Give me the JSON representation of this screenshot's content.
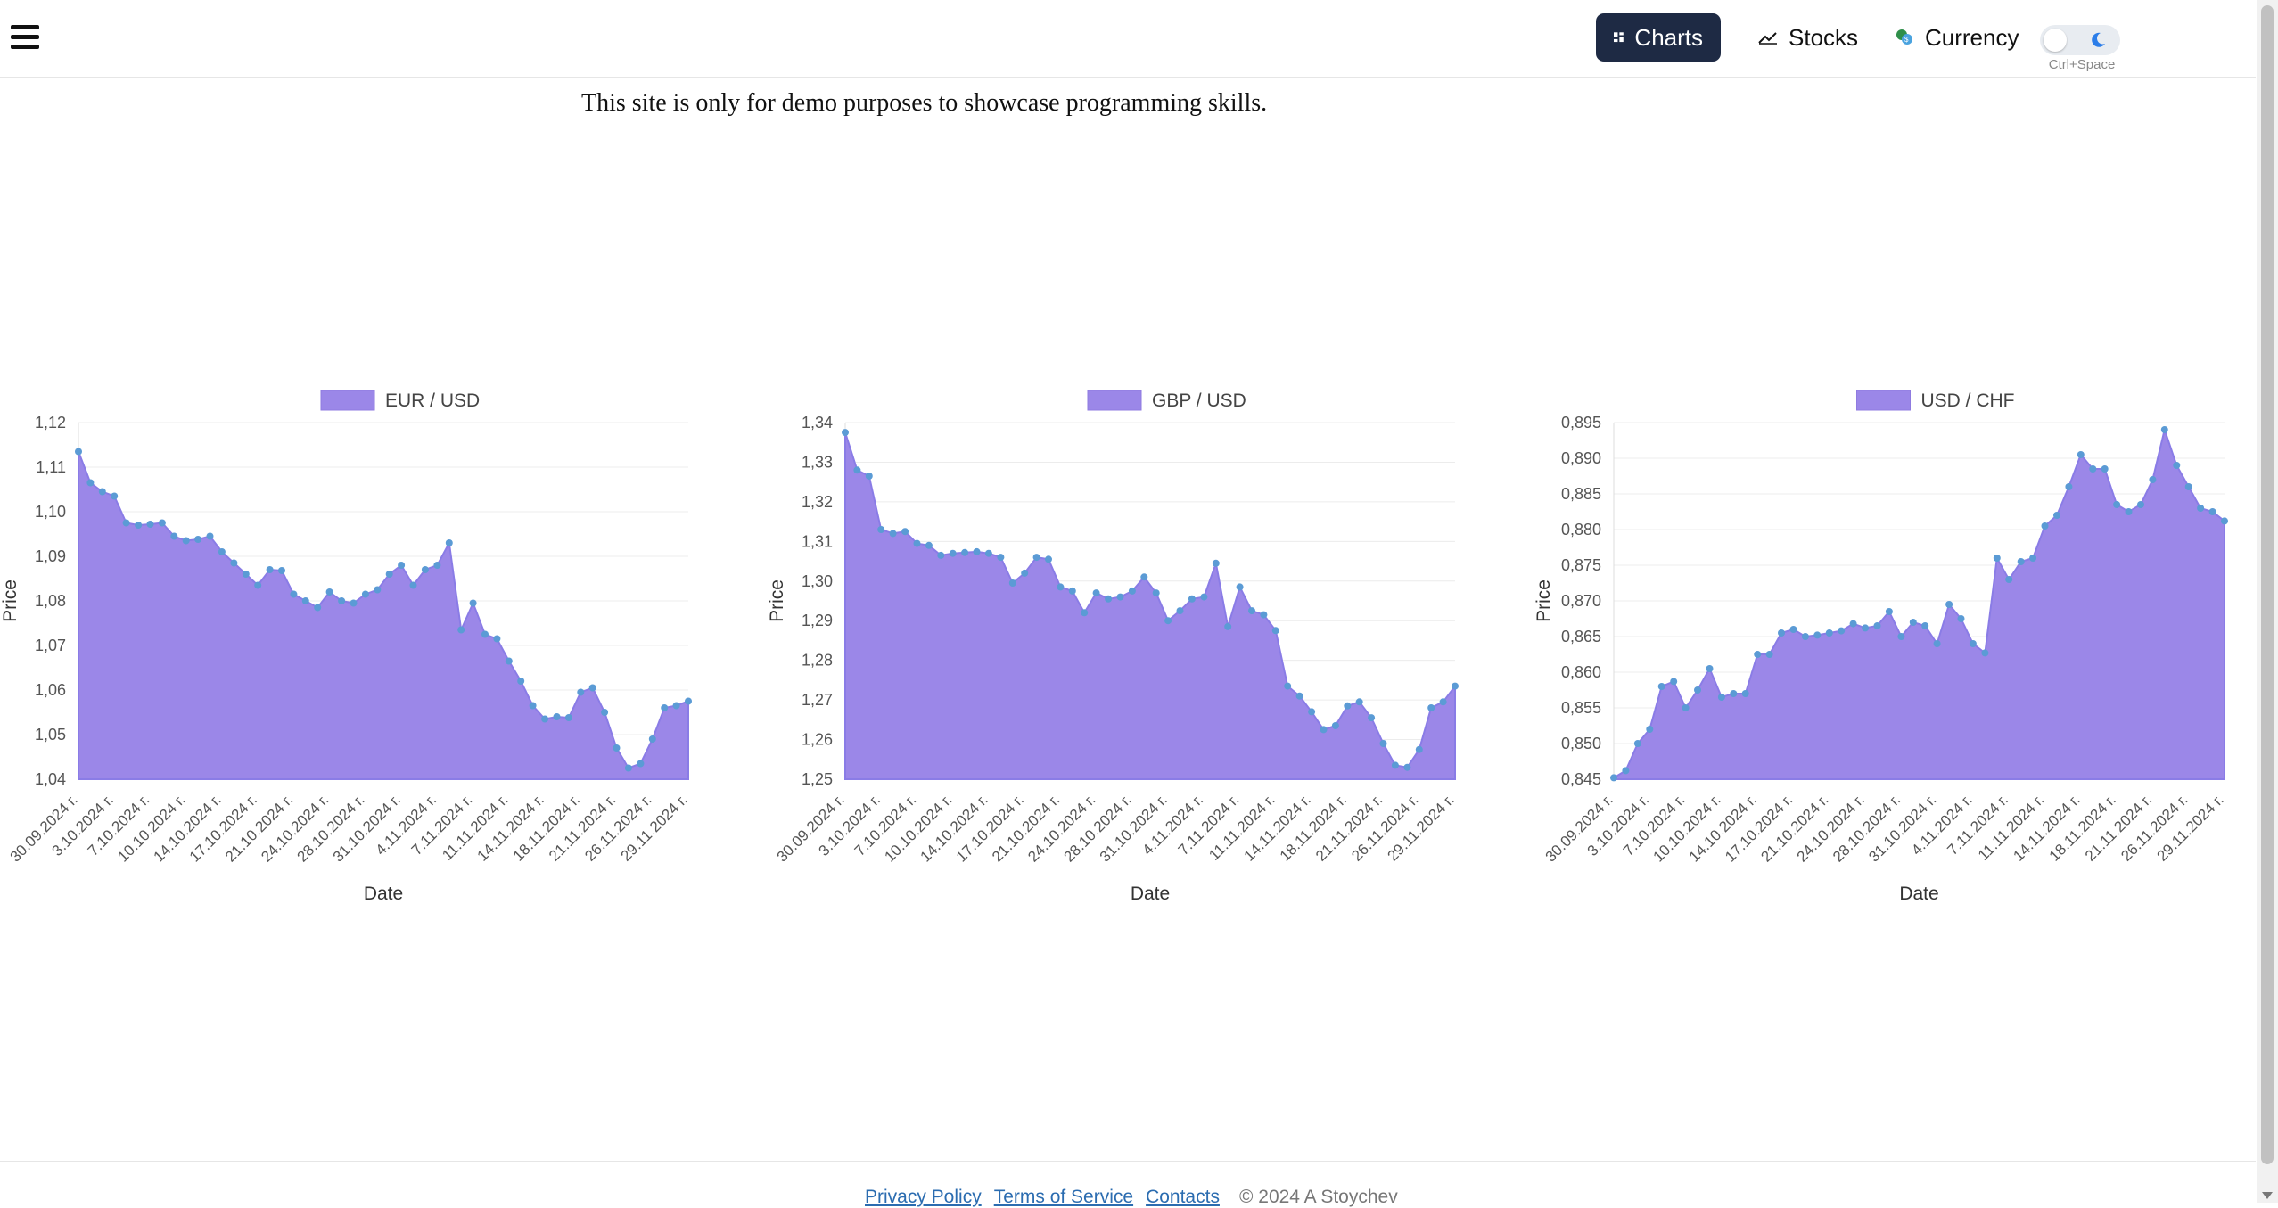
{
  "header": {
    "menu_icon": "hamburger-icon",
    "nav": [
      {
        "label": "Charts",
        "icon": "dashboard-icon",
        "active": true
      },
      {
        "label": "Stocks",
        "icon": "trend-icon",
        "active": false
      },
      {
        "label": "Currency",
        "icon": "currency-icon",
        "active": false
      }
    ],
    "theme_toggle": {
      "icon": "moon-icon",
      "shortcut": "Ctrl+Space"
    }
  },
  "intro": "This site is only for demo purposes to showcase programming skills.",
  "footer": {
    "links": [
      "Privacy Policy",
      "Terms of Service",
      "Contacts"
    ],
    "copyright": "© 2024 A Stoychev"
  },
  "colors": {
    "fill": "#9b87e8",
    "point": "#5b9bd5",
    "nav_active": "#1e2a44"
  },
  "chart_data": [
    {
      "type": "area",
      "legend": "EUR / USD",
      "xlabel": "Date",
      "ylabel": "Price",
      "ylim": [
        1.04,
        1.12
      ],
      "y_ticks": [
        "1,04",
        "1,05",
        "1,06",
        "1,07",
        "1,08",
        "1,09",
        "1,10",
        "1,11",
        "1,12"
      ],
      "x_ticks": [
        "30.09.2024 г.",
        "3.10.2024 г.",
        "7.10.2024 г.",
        "10.10.2024 г.",
        "14.10.2024 г.",
        "17.10.2024 г.",
        "21.10.2024 г.",
        "24.10.2024 г.",
        "28.10.2024 г.",
        "31.10.2024 г.",
        "4.11.2024 г.",
        "7.11.2024 г.",
        "11.11.2024 г.",
        "14.11.2024 г.",
        "18.11.2024 г.",
        "21.11.2024 г.",
        "26.11.2024 г.",
        "29.11.2024 г."
      ],
      "values": [
        1.1135,
        1.1065,
        1.1045,
        1.1035,
        1.0975,
        1.097,
        1.0972,
        1.0975,
        1.0945,
        1.0935,
        1.0938,
        1.0945,
        1.091,
        1.0885,
        1.086,
        1.0835,
        1.087,
        1.0868,
        1.0815,
        1.08,
        1.0785,
        1.082,
        1.08,
        1.0795,
        1.0815,
        1.0825,
        1.086,
        1.088,
        1.0835,
        1.087,
        1.088,
        1.093,
        1.0735,
        1.0795,
        1.0725,
        1.0715,
        1.0665,
        1.062,
        1.0565,
        1.0535,
        1.054,
        1.0538,
        1.0595,
        1.0605,
        1.055,
        1.047,
        1.0425,
        1.0435,
        1.049,
        1.056,
        1.0565,
        1.0575
      ]
    },
    {
      "type": "area",
      "legend": "GBP / USD",
      "xlabel": "Date",
      "ylabel": "Price",
      "ylim": [
        1.25,
        1.34
      ],
      "y_ticks": [
        "1,25",
        "1,26",
        "1,27",
        "1,28",
        "1,29",
        "1,30",
        "1,31",
        "1,32",
        "1,33",
        "1,34"
      ],
      "x_ticks": [
        "30.09.2024 г.",
        "3.10.2024 г.",
        "7.10.2024 г.",
        "10.10.2024 г.",
        "14.10.2024 г.",
        "17.10.2024 г.",
        "21.10.2024 г.",
        "24.10.2024 г.",
        "28.10.2024 г.",
        "31.10.2024 г.",
        "4.11.2024 г.",
        "7.11.2024 г.",
        "11.11.2024 г.",
        "14.11.2024 г.",
        "18.11.2024 г.",
        "21.11.2024 г.",
        "26.11.2024 г.",
        "29.11.2024 г."
      ],
      "values": [
        1.3375,
        1.328,
        1.3265,
        1.313,
        1.312,
        1.3125,
        1.3095,
        1.309,
        1.3065,
        1.307,
        1.3072,
        1.3074,
        1.307,
        1.306,
        1.2995,
        1.302,
        1.306,
        1.3055,
        1.2985,
        1.2975,
        1.292,
        1.297,
        1.2955,
        1.296,
        1.2975,
        1.301,
        1.297,
        1.29,
        1.2925,
        1.2955,
        1.296,
        1.3045,
        1.2885,
        1.2985,
        1.2925,
        1.2915,
        1.2875,
        1.2735,
        1.271,
        1.267,
        1.2625,
        1.2635,
        1.2685,
        1.2695,
        1.2655,
        1.259,
        1.2535,
        1.253,
        1.2575,
        1.268,
        1.2695,
        1.2735
      ]
    },
    {
      "type": "area",
      "legend": "USD / CHF",
      "xlabel": "Date",
      "ylabel": "Price",
      "ylim": [
        0.845,
        0.895
      ],
      "y_ticks": [
        "0,845",
        "0,850",
        "0,855",
        "0,860",
        "0,865",
        "0,870",
        "0,875",
        "0,880",
        "0,885",
        "0,890",
        "0,895"
      ],
      "x_ticks": [
        "30.09.2024 г.",
        "3.10.2024 г.",
        "7.10.2024 г.",
        "10.10.2024 г.",
        "14.10.2024 г.",
        "17.10.2024 г.",
        "21.10.2024 г.",
        "24.10.2024 г.",
        "28.10.2024 г.",
        "31.10.2024 г.",
        "4.11.2024 г.",
        "7.11.2024 г.",
        "11.11.2024 г.",
        "14.11.2024 г.",
        "18.11.2024 г.",
        "21.11.2024 г.",
        "26.11.2024 г.",
        "29.11.2024 г."
      ],
      "values": [
        0.8452,
        0.8462,
        0.85,
        0.852,
        0.858,
        0.8587,
        0.855,
        0.8575,
        0.8605,
        0.8565,
        0.857,
        0.857,
        0.8625,
        0.8625,
        0.8655,
        0.866,
        0.865,
        0.8652,
        0.8655,
        0.8658,
        0.8668,
        0.8662,
        0.8665,
        0.8685,
        0.865,
        0.867,
        0.8665,
        0.864,
        0.8695,
        0.8675,
        0.864,
        0.8627,
        0.876,
        0.873,
        0.8755,
        0.876,
        0.8805,
        0.882,
        0.886,
        0.8905,
        0.8885,
        0.8885,
        0.8835,
        0.8825,
        0.8835,
        0.887,
        0.894,
        0.889,
        0.886,
        0.883,
        0.8825,
        0.8812
      ]
    }
  ]
}
